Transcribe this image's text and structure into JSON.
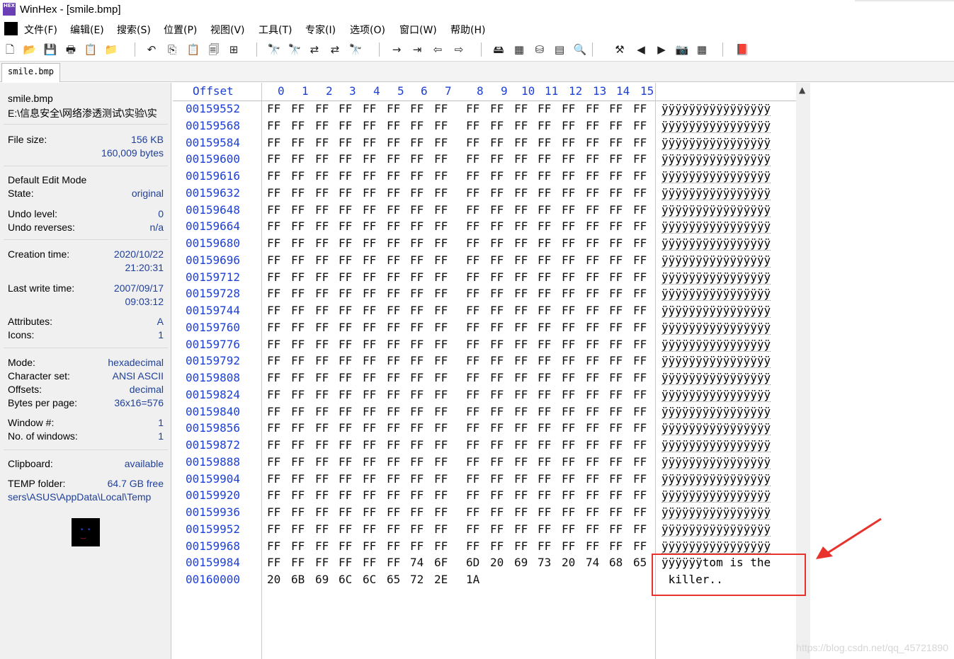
{
  "window": {
    "app_icon_label": "HEX",
    "title": "WinHex - [smile.bmp]"
  },
  "menu": {
    "items": [
      "文件(F)",
      "编辑(E)",
      "搜索(S)",
      "位置(P)",
      "视图(V)",
      "工具(T)",
      "专家(I)",
      "选项(O)",
      "窗口(W)",
      "帮助(H)"
    ]
  },
  "toolbar": {
    "buttons": [
      {
        "icon": "new-file-icon",
        "glyph": "🗋"
      },
      {
        "icon": "open-folder-icon",
        "glyph": "📂"
      },
      {
        "icon": "save-icon",
        "glyph": "💾"
      },
      {
        "icon": "print-icon",
        "glyph": "🖶"
      },
      {
        "icon": "properties-icon",
        "glyph": "📋"
      },
      {
        "icon": "open-disk-icon",
        "glyph": "📁"
      },
      {
        "icon": "undo-icon",
        "glyph": "↶"
      },
      {
        "icon": "copy-icon",
        "glyph": "⎘"
      },
      {
        "icon": "paste-icon",
        "glyph": "📋"
      },
      {
        "icon": "paste-write-icon",
        "glyph": "🗐"
      },
      {
        "icon": "binary-icon",
        "glyph": "⊞"
      },
      {
        "icon": "find-icon",
        "glyph": "🔭"
      },
      {
        "icon": "find-hex-icon",
        "glyph": "🔭"
      },
      {
        "icon": "replace-icon",
        "glyph": "⇄"
      },
      {
        "icon": "replace-hex-icon",
        "glyph": "⇄"
      },
      {
        "icon": "find-again-icon",
        "glyph": "🔭"
      },
      {
        "icon": "goto-offset-icon",
        "glyph": "→"
      },
      {
        "icon": "goto-icon",
        "glyph": "⇥"
      },
      {
        "icon": "back-icon",
        "glyph": "⇦"
      },
      {
        "icon": "forward-icon",
        "glyph": "⇨"
      },
      {
        "icon": "disk-editor-icon",
        "glyph": "🖴"
      },
      {
        "icon": "ram-editor-icon",
        "glyph": "▦"
      },
      {
        "icon": "disk-clone-icon",
        "glyph": "⛁"
      },
      {
        "icon": "calculator-icon",
        "glyph": "▤"
      },
      {
        "icon": "search-icon",
        "glyph": "🔍"
      },
      {
        "icon": "tools-icon",
        "glyph": "⚒"
      },
      {
        "icon": "prev-icon",
        "glyph": "◀"
      },
      {
        "icon": "next-icon",
        "glyph": "▶"
      },
      {
        "icon": "camera-icon",
        "glyph": "📷"
      },
      {
        "icon": "table-icon",
        "glyph": "▦"
      },
      {
        "icon": "help-book-icon",
        "glyph": "📕"
      }
    ]
  },
  "tab": {
    "label": "smile.bmp"
  },
  "info": {
    "filename": "smile.bmp",
    "path": "E:\\信息安全\\网络渗透测试\\实验\\实",
    "file_size_label": "File size:",
    "file_size_kb": "156 KB",
    "file_size_bytes": "160,009 bytes",
    "default_edit_mode": "Default Edit Mode",
    "state_label": "State:",
    "state_value": "original",
    "undo_level_label": "Undo level:",
    "undo_level_value": "0",
    "undo_reverses_label": "Undo reverses:",
    "undo_reverses_value": "n/a",
    "creation_label": "Creation time:",
    "creation_date": "2020/10/22",
    "creation_time": "21:20:31",
    "lastwrite_label": "Last write time:",
    "lastwrite_date": "2007/09/17",
    "lastwrite_time": "09:03:12",
    "attributes_label": "Attributes:",
    "attributes_value": "A",
    "icons_label": "Icons:",
    "icons_value": "1",
    "mode_label": "Mode:",
    "mode_value": "hexadecimal",
    "charset_label": "Character set:",
    "charset_value": "ANSI ASCII",
    "offsets_label": "Offsets:",
    "offsets_value": "decimal",
    "bpp_label": "Bytes per page:",
    "bpp_value": "36x16=576",
    "window_label": "Window #:",
    "window_value": "1",
    "nwindows_label": "No. of windows:",
    "nwindows_value": "1",
    "clipboard_label": "Clipboard:",
    "clipboard_value": "available",
    "temp_label": "TEMP folder:",
    "temp_value": "64.7 GB free",
    "temp_path": "sers\\ASUS\\AppData\\Local\\Temp"
  },
  "hex": {
    "offset_header": "Offset",
    "columns": [
      "0",
      "1",
      "2",
      "3",
      "4",
      "5",
      "6",
      "7",
      "8",
      "9",
      "10",
      "11",
      "12",
      "13",
      "14",
      "15"
    ],
    "rows": [
      {
        "offset": "00159552",
        "bytes": [
          "FF",
          "FF",
          "FF",
          "FF",
          "FF",
          "FF",
          "FF",
          "FF",
          "FF",
          "FF",
          "FF",
          "FF",
          "FF",
          "FF",
          "FF",
          "FF"
        ],
        "text": "ÿÿÿÿÿÿÿÿÿÿÿÿÿÿÿÿ"
      },
      {
        "offset": "00159568",
        "bytes": [
          "FF",
          "FF",
          "FF",
          "FF",
          "FF",
          "FF",
          "FF",
          "FF",
          "FF",
          "FF",
          "FF",
          "FF",
          "FF",
          "FF",
          "FF",
          "FF"
        ],
        "text": "ÿÿÿÿÿÿÿÿÿÿÿÿÿÿÿÿ"
      },
      {
        "offset": "00159584",
        "bytes": [
          "FF",
          "FF",
          "FF",
          "FF",
          "FF",
          "FF",
          "FF",
          "FF",
          "FF",
          "FF",
          "FF",
          "FF",
          "FF",
          "FF",
          "FF",
          "FF"
        ],
        "text": "ÿÿÿÿÿÿÿÿÿÿÿÿÿÿÿÿ"
      },
      {
        "offset": "00159600",
        "bytes": [
          "FF",
          "FF",
          "FF",
          "FF",
          "FF",
          "FF",
          "FF",
          "FF",
          "FF",
          "FF",
          "FF",
          "FF",
          "FF",
          "FF",
          "FF",
          "FF"
        ],
        "text": "ÿÿÿÿÿÿÿÿÿÿÿÿÿÿÿÿ"
      },
      {
        "offset": "00159616",
        "bytes": [
          "FF",
          "FF",
          "FF",
          "FF",
          "FF",
          "FF",
          "FF",
          "FF",
          "FF",
          "FF",
          "FF",
          "FF",
          "FF",
          "FF",
          "FF",
          "FF"
        ],
        "text": "ÿÿÿÿÿÿÿÿÿÿÿÿÿÿÿÿ"
      },
      {
        "offset": "00159632",
        "bytes": [
          "FF",
          "FF",
          "FF",
          "FF",
          "FF",
          "FF",
          "FF",
          "FF",
          "FF",
          "FF",
          "FF",
          "FF",
          "FF",
          "FF",
          "FF",
          "FF"
        ],
        "text": "ÿÿÿÿÿÿÿÿÿÿÿÿÿÿÿÿ"
      },
      {
        "offset": "00159648",
        "bytes": [
          "FF",
          "FF",
          "FF",
          "FF",
          "FF",
          "FF",
          "FF",
          "FF",
          "FF",
          "FF",
          "FF",
          "FF",
          "FF",
          "FF",
          "FF",
          "FF"
        ],
        "text": "ÿÿÿÿÿÿÿÿÿÿÿÿÿÿÿÿ"
      },
      {
        "offset": "00159664",
        "bytes": [
          "FF",
          "FF",
          "FF",
          "FF",
          "FF",
          "FF",
          "FF",
          "FF",
          "FF",
          "FF",
          "FF",
          "FF",
          "FF",
          "FF",
          "FF",
          "FF"
        ],
        "text": "ÿÿÿÿÿÿÿÿÿÿÿÿÿÿÿÿ"
      },
      {
        "offset": "00159680",
        "bytes": [
          "FF",
          "FF",
          "FF",
          "FF",
          "FF",
          "FF",
          "FF",
          "FF",
          "FF",
          "FF",
          "FF",
          "FF",
          "FF",
          "FF",
          "FF",
          "FF"
        ],
        "text": "ÿÿÿÿÿÿÿÿÿÿÿÿÿÿÿÿ"
      },
      {
        "offset": "00159696",
        "bytes": [
          "FF",
          "FF",
          "FF",
          "FF",
          "FF",
          "FF",
          "FF",
          "FF",
          "FF",
          "FF",
          "FF",
          "FF",
          "FF",
          "FF",
          "FF",
          "FF"
        ],
        "text": "ÿÿÿÿÿÿÿÿÿÿÿÿÿÿÿÿ"
      },
      {
        "offset": "00159712",
        "bytes": [
          "FF",
          "FF",
          "FF",
          "FF",
          "FF",
          "FF",
          "FF",
          "FF",
          "FF",
          "FF",
          "FF",
          "FF",
          "FF",
          "FF",
          "FF",
          "FF"
        ],
        "text": "ÿÿÿÿÿÿÿÿÿÿÿÿÿÿÿÿ"
      },
      {
        "offset": "00159728",
        "bytes": [
          "FF",
          "FF",
          "FF",
          "FF",
          "FF",
          "FF",
          "FF",
          "FF",
          "FF",
          "FF",
          "FF",
          "FF",
          "FF",
          "FF",
          "FF",
          "FF"
        ],
        "text": "ÿÿÿÿÿÿÿÿÿÿÿÿÿÿÿÿ"
      },
      {
        "offset": "00159744",
        "bytes": [
          "FF",
          "FF",
          "FF",
          "FF",
          "FF",
          "FF",
          "FF",
          "FF",
          "FF",
          "FF",
          "FF",
          "FF",
          "FF",
          "FF",
          "FF",
          "FF"
        ],
        "text": "ÿÿÿÿÿÿÿÿÿÿÿÿÿÿÿÿ"
      },
      {
        "offset": "00159760",
        "bytes": [
          "FF",
          "FF",
          "FF",
          "FF",
          "FF",
          "FF",
          "FF",
          "FF",
          "FF",
          "FF",
          "FF",
          "FF",
          "FF",
          "FF",
          "FF",
          "FF"
        ],
        "text": "ÿÿÿÿÿÿÿÿÿÿÿÿÿÿÿÿ"
      },
      {
        "offset": "00159776",
        "bytes": [
          "FF",
          "FF",
          "FF",
          "FF",
          "FF",
          "FF",
          "FF",
          "FF",
          "FF",
          "FF",
          "FF",
          "FF",
          "FF",
          "FF",
          "FF",
          "FF"
        ],
        "text": "ÿÿÿÿÿÿÿÿÿÿÿÿÿÿÿÿ"
      },
      {
        "offset": "00159792",
        "bytes": [
          "FF",
          "FF",
          "FF",
          "FF",
          "FF",
          "FF",
          "FF",
          "FF",
          "FF",
          "FF",
          "FF",
          "FF",
          "FF",
          "FF",
          "FF",
          "FF"
        ],
        "text": "ÿÿÿÿÿÿÿÿÿÿÿÿÿÿÿÿ"
      },
      {
        "offset": "00159808",
        "bytes": [
          "FF",
          "FF",
          "FF",
          "FF",
          "FF",
          "FF",
          "FF",
          "FF",
          "FF",
          "FF",
          "FF",
          "FF",
          "FF",
          "FF",
          "FF",
          "FF"
        ],
        "text": "ÿÿÿÿÿÿÿÿÿÿÿÿÿÿÿÿ"
      },
      {
        "offset": "00159824",
        "bytes": [
          "FF",
          "FF",
          "FF",
          "FF",
          "FF",
          "FF",
          "FF",
          "FF",
          "FF",
          "FF",
          "FF",
          "FF",
          "FF",
          "FF",
          "FF",
          "FF"
        ],
        "text": "ÿÿÿÿÿÿÿÿÿÿÿÿÿÿÿÿ"
      },
      {
        "offset": "00159840",
        "bytes": [
          "FF",
          "FF",
          "FF",
          "FF",
          "FF",
          "FF",
          "FF",
          "FF",
          "FF",
          "FF",
          "FF",
          "FF",
          "FF",
          "FF",
          "FF",
          "FF"
        ],
        "text": "ÿÿÿÿÿÿÿÿÿÿÿÿÿÿÿÿ"
      },
      {
        "offset": "00159856",
        "bytes": [
          "FF",
          "FF",
          "FF",
          "FF",
          "FF",
          "FF",
          "FF",
          "FF",
          "FF",
          "FF",
          "FF",
          "FF",
          "FF",
          "FF",
          "FF",
          "FF"
        ],
        "text": "ÿÿÿÿÿÿÿÿÿÿÿÿÿÿÿÿ"
      },
      {
        "offset": "00159872",
        "bytes": [
          "FF",
          "FF",
          "FF",
          "FF",
          "FF",
          "FF",
          "FF",
          "FF",
          "FF",
          "FF",
          "FF",
          "FF",
          "FF",
          "FF",
          "FF",
          "FF"
        ],
        "text": "ÿÿÿÿÿÿÿÿÿÿÿÿÿÿÿÿ"
      },
      {
        "offset": "00159888",
        "bytes": [
          "FF",
          "FF",
          "FF",
          "FF",
          "FF",
          "FF",
          "FF",
          "FF",
          "FF",
          "FF",
          "FF",
          "FF",
          "FF",
          "FF",
          "FF",
          "FF"
        ],
        "text": "ÿÿÿÿÿÿÿÿÿÿÿÿÿÿÿÿ"
      },
      {
        "offset": "00159904",
        "bytes": [
          "FF",
          "FF",
          "FF",
          "FF",
          "FF",
          "FF",
          "FF",
          "FF",
          "FF",
          "FF",
          "FF",
          "FF",
          "FF",
          "FF",
          "FF",
          "FF"
        ],
        "text": "ÿÿÿÿÿÿÿÿÿÿÿÿÿÿÿÿ"
      },
      {
        "offset": "00159920",
        "bytes": [
          "FF",
          "FF",
          "FF",
          "FF",
          "FF",
          "FF",
          "FF",
          "FF",
          "FF",
          "FF",
          "FF",
          "FF",
          "FF",
          "FF",
          "FF",
          "FF"
        ],
        "text": "ÿÿÿÿÿÿÿÿÿÿÿÿÿÿÿÿ"
      },
      {
        "offset": "00159936",
        "bytes": [
          "FF",
          "FF",
          "FF",
          "FF",
          "FF",
          "FF",
          "FF",
          "FF",
          "FF",
          "FF",
          "FF",
          "FF",
          "FF",
          "FF",
          "FF",
          "FF"
        ],
        "text": "ÿÿÿÿÿÿÿÿÿÿÿÿÿÿÿÿ"
      },
      {
        "offset": "00159952",
        "bytes": [
          "FF",
          "FF",
          "FF",
          "FF",
          "FF",
          "FF",
          "FF",
          "FF",
          "FF",
          "FF",
          "FF",
          "FF",
          "FF",
          "FF",
          "FF",
          "FF"
        ],
        "text": "ÿÿÿÿÿÿÿÿÿÿÿÿÿÿÿÿ"
      },
      {
        "offset": "00159968",
        "bytes": [
          "FF",
          "FF",
          "FF",
          "FF",
          "FF",
          "FF",
          "FF",
          "FF",
          "FF",
          "FF",
          "FF",
          "FF",
          "FF",
          "FF",
          "FF",
          "FF"
        ],
        "text": "ÿÿÿÿÿÿÿÿÿÿÿÿÿÿÿÿ"
      },
      {
        "offset": "00159984",
        "bytes": [
          "FF",
          "FF",
          "FF",
          "FF",
          "FF",
          "FF",
          "74",
          "6F",
          "6D",
          "20",
          "69",
          "73",
          "20",
          "74",
          "68",
          "65"
        ],
        "text": "ÿÿÿÿÿÿtom is the"
      },
      {
        "offset": "00160000",
        "bytes": [
          "20",
          "6B",
          "69",
          "6C",
          "6C",
          "65",
          "72",
          "2E",
          "1A"
        ],
        "text": " killer.."
      }
    ]
  },
  "watermark": "https://blog.csdn.net/qq_45721890",
  "colors": {
    "offset_blue": "#1c3fd8",
    "annotation_red": "#e8322c"
  }
}
